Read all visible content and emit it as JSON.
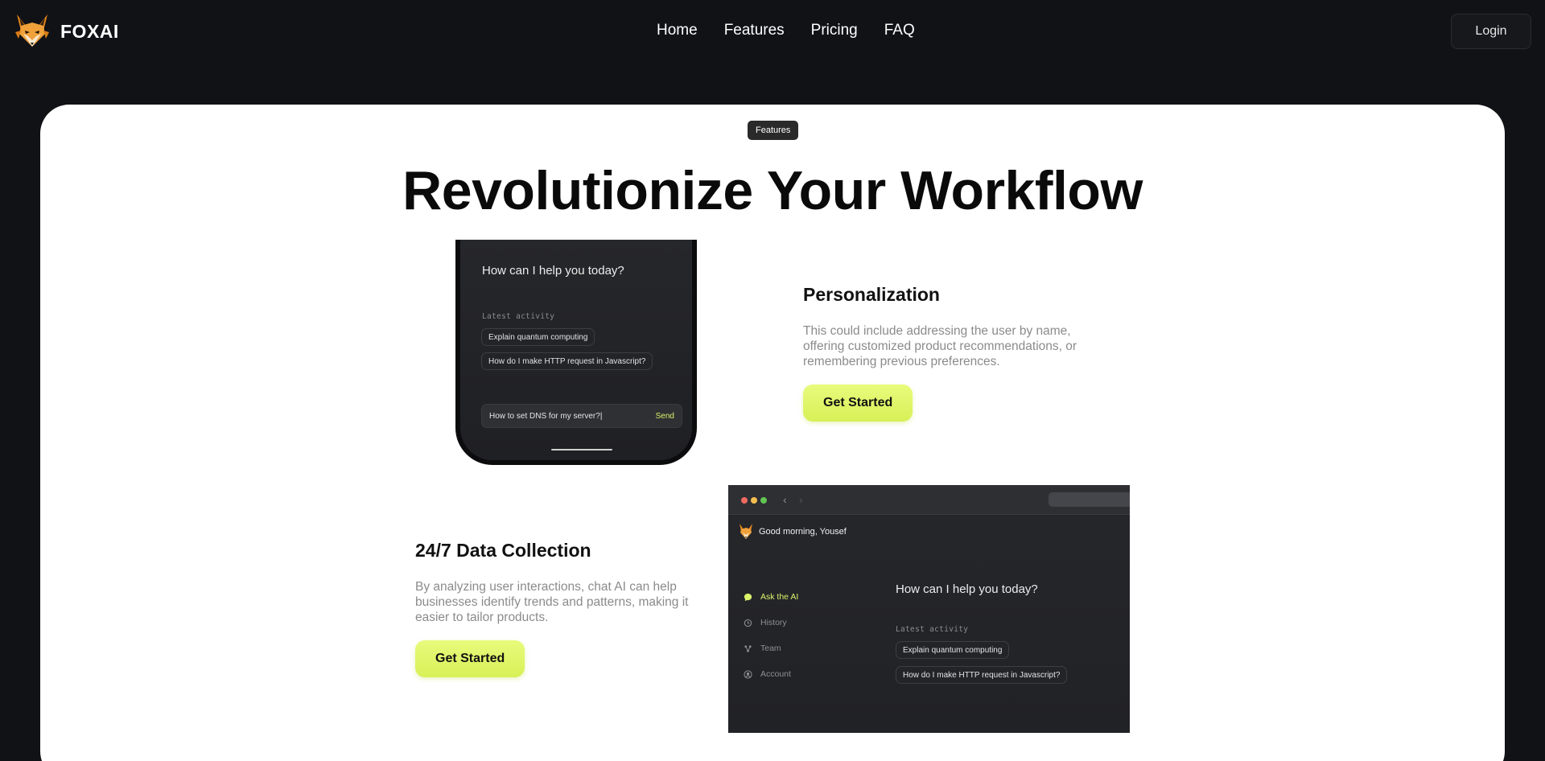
{
  "brand": {
    "name": "FOXAI"
  },
  "nav": {
    "links": [
      "Home",
      "Features",
      "Pricing",
      "FAQ"
    ],
    "login": "Login"
  },
  "hero": {
    "badge": "Features",
    "title": "Revolutionize Your Workflow"
  },
  "phone": {
    "question": "How can I help you today?",
    "latest_label": "Latest activity",
    "chips": [
      "Explain quantum computing",
      "How do I make HTTP request in Javascript?"
    ],
    "input_value": "How to set DNS for my server?|",
    "send_label": "Send"
  },
  "feature_personalization": {
    "title": "Personalization",
    "desc_lines": [
      "This could include addressing the user by name,",
      "offering customized product recommendations, or",
      "remembering previous preferences."
    ],
    "cta": "Get Started"
  },
  "feature_data": {
    "title": "24/7 Data Collection",
    "desc_lines": [
      "By analyzing user interactions, chat AI can help",
      "businesses identify trends and patterns, making it",
      "easier to tailor products."
    ],
    "cta": "Get Started"
  },
  "window": {
    "greeting": "Good morning, Yousef",
    "sidebar": [
      {
        "label": "Ask the AI",
        "icon": "chat-icon",
        "active": true
      },
      {
        "label": "History",
        "icon": "history-icon",
        "active": false
      },
      {
        "label": "Team",
        "icon": "team-icon",
        "active": false
      },
      {
        "label": "Account",
        "icon": "account-icon",
        "active": false
      }
    ],
    "question": "How can I help you today?",
    "latest_label": "Latest activity",
    "chips": [
      "Explain quantum computing",
      "How do I make HTTP request in Javascript?"
    ]
  },
  "colors": {
    "background": "#111216",
    "accent": "#d9f36a",
    "cta": "#e2f86d",
    "traffic_red": "#ee6a5f",
    "traffic_yellow": "#f5be4f",
    "traffic_green": "#62c554"
  }
}
